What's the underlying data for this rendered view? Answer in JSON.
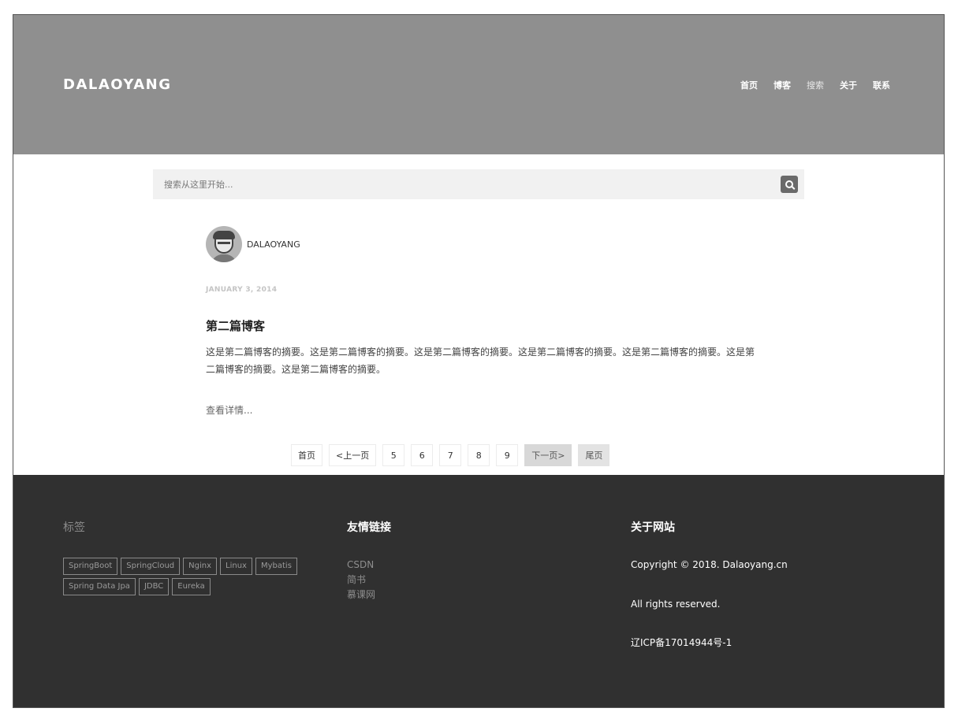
{
  "header": {
    "brand": "DALAOYANG",
    "nav": [
      {
        "label": "首页"
      },
      {
        "label": "博客"
      },
      {
        "label": "搜索",
        "active": true
      },
      {
        "label": "关于"
      },
      {
        "label": "联系"
      }
    ],
    "bg_color": "#8f8f8f"
  },
  "search": {
    "placeholder": "搜索从这里开始...",
    "button_icon": "search-icon"
  },
  "post": {
    "author": "DALAOYANG",
    "date": "JANUARY 3, 2014",
    "title": "第二篇博客",
    "summary": "这是第二篇博客的摘要。这是第二篇博客的摘要。这是第二篇博客的摘要。这是第二篇博客的摘要。这是第二篇博客的摘要。这是第二篇博客的摘要。这是第二篇博客的摘要。",
    "read_more": "查看详情..."
  },
  "pagination": {
    "first": "首页",
    "prev": "<上一页",
    "pages": [
      "5",
      "6",
      "7",
      "8",
      "9"
    ],
    "next": "下一页>",
    "last": "尾页"
  },
  "footer": {
    "bg_color": "#303030",
    "tags_title": "标签",
    "tags": [
      "SpringBoot",
      "SpringCloud",
      "Nginx",
      "Linux",
      "Mybatis",
      "Spring Data Jpa",
      "JDBC",
      "Eureka"
    ],
    "links_title": "友情链接",
    "links": [
      "CSDN",
      "简书",
      "慕课网"
    ],
    "about_title": "关于网站",
    "about_lines": [
      "Copyright © 2018. Dalaoyang.cn",
      "All rights reserved.",
      "辽ICP备17014944号-1"
    ]
  }
}
